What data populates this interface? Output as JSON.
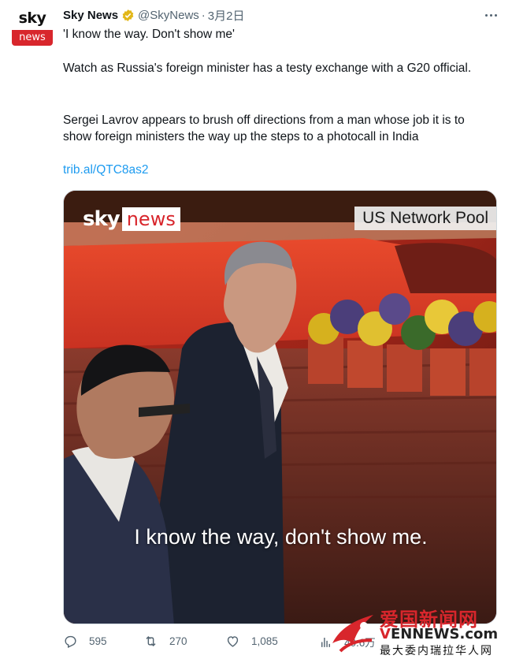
{
  "tweet": {
    "author_name": "Sky News",
    "handle": "@SkyNews",
    "separator": "·",
    "date": "3月2日",
    "avatar": {
      "top_text": "sky",
      "bottom_text": "news"
    },
    "line1": "'I know the way. Don't show me'",
    "line2": "Watch as Russia's foreign minister has a testy exchange with a G20 official.",
    "line3": "Sergei Lavrov appears to brush off directions from a man whose job it is to show foreign ministers the way up the steps to a photocall in India",
    "link": "trib.al/QTC8as2"
  },
  "media": {
    "logo_sky": "sky",
    "logo_news": "news",
    "pool_label": "US Network Pool",
    "caption": "I know the way, don't show me."
  },
  "actions": {
    "replies": "595",
    "retweets": "270",
    "likes": "1,085",
    "views": "40.6万"
  },
  "watermark": {
    "title": "爱国新闻网",
    "url_v": "V",
    "url_rest": "ENNEWS.com",
    "subtitle": "最大委内瑞拉华人网"
  },
  "colors": {
    "link": "#1d9bf0",
    "secondary_text": "#536471",
    "brand_red": "#d8262c",
    "verified_gold": "#e2b719"
  }
}
